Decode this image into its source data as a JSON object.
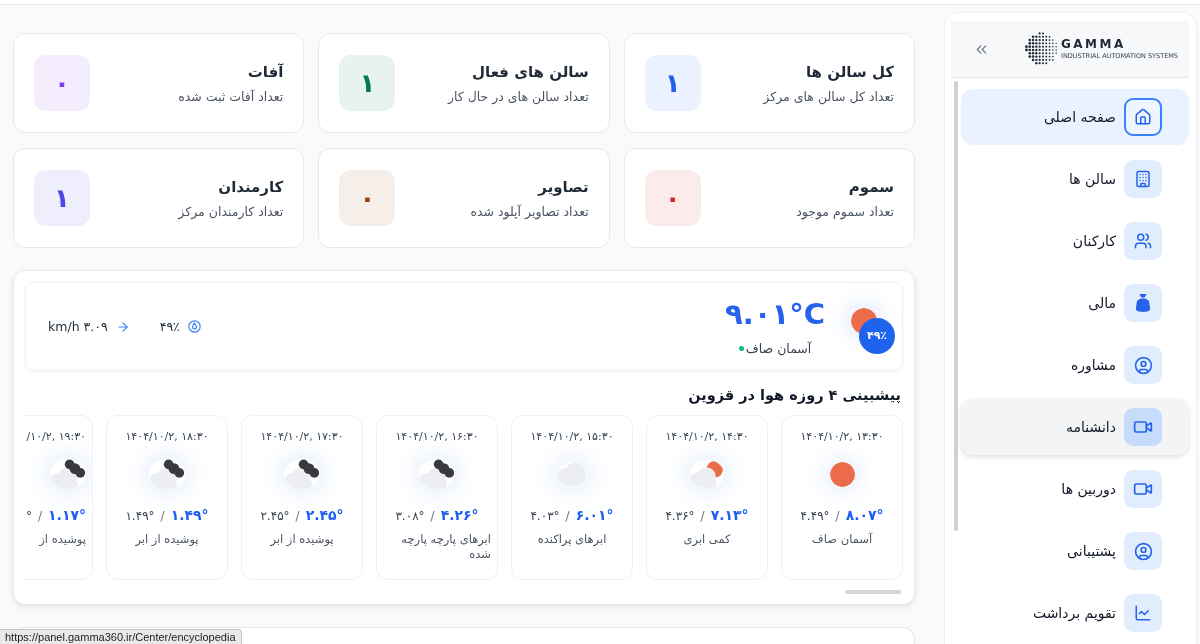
{
  "sidebar": {
    "logo": {
      "name": "GAMMA",
      "tagline": "INDUSTRIAL AUTOMATION SYSTEMS"
    },
    "items": [
      {
        "label": "صفحه اصلی",
        "selected": true,
        "hovered": false
      },
      {
        "label": "سالن ها",
        "selected": false,
        "hovered": false
      },
      {
        "label": "کارکنان",
        "selected": false,
        "hovered": false
      },
      {
        "label": "مالی",
        "selected": false,
        "hovered": false
      },
      {
        "label": "مشاوره",
        "selected": false,
        "hovered": false
      },
      {
        "label": "دانشنامه",
        "selected": false,
        "hovered": true
      },
      {
        "label": "دوربین ها",
        "selected": false,
        "hovered": false
      },
      {
        "label": "پشتیبانی",
        "selected": false,
        "hovered": false
      },
      {
        "label": "تقویم برداشت",
        "selected": false,
        "hovered": false
      }
    ]
  },
  "stats": [
    {
      "title": "کل سالن ها",
      "subtitle": "تعداد کل سالن های مرکز",
      "value": "۱",
      "color": "#1d5ff0"
    },
    {
      "title": "سالن های فعال",
      "subtitle": "تعداد سالن های در حال کار",
      "value": "۱",
      "color": "#047857"
    },
    {
      "title": "آفات",
      "subtitle": "تعداد آفات ثبت شده",
      "value": "۰",
      "color": "#7c3aed"
    },
    {
      "title": "سموم",
      "subtitle": "تعداد سموم موجود",
      "value": "۰",
      "color": "#dc2626"
    },
    {
      "title": "تصاویر",
      "subtitle": "تعداد تصاویر آپلود شده",
      "value": "۰",
      "color": "#92400e"
    },
    {
      "title": "کارمندان",
      "subtitle": "تعداد کارمندان مرکز",
      "value": "۱",
      "color": "#4f46e5"
    }
  ],
  "weather": {
    "current": {
      "kind": "clear",
      "badge": "۴۹٪",
      "temperature": "۹.۰۱°C",
      "condition": "آسمان صاف",
      "humidity": "۴۹٪",
      "wind": "۳.۰۹ km/h"
    },
    "forecast_title": "پیشبینی ۴ روزه هوا در قزوین",
    "forecast": [
      {
        "time": "۱۴۰۴/۱۰/۲, ۱۳:۳۰",
        "kind": "clear",
        "max": "۸.۰۷°",
        "separator": "/",
        "min": "۴.۴۹°",
        "description": "آسمان صاف"
      },
      {
        "time": "۱۴۰۴/۱۰/۲, ۱۴:۳۰",
        "kind": "few-clouds",
        "max": "۷.۱۳°",
        "separator": "/",
        "min": "۴.۳۶°",
        "description": "کمی ابری"
      },
      {
        "time": "۱۴۰۴/۱۰/۲, ۱۵:۳۰",
        "kind": "scattered",
        "max": "۶.۰۱°",
        "separator": "/",
        "min": "۴.۰۳°",
        "description": "ابرهای پراکنده"
      },
      {
        "time": "۱۴۰۴/۱۰/۲, ۱۶:۳۰",
        "kind": "broken",
        "max": "۴.۲۶°",
        "separator": "/",
        "min": "۳.۰۸°",
        "description": "ابرهای پارچه پارچه شده"
      },
      {
        "time": "۱۴۰۴/۱۰/۲, ۱۷:۳۰",
        "kind": "overcast",
        "max": "۲.۴۵°",
        "separator": "/",
        "min": "۲.۴۵°",
        "description": "پوشیده از ابر"
      },
      {
        "time": "۱۴۰۴/۱۰/۲, ۱۸:۳۰",
        "kind": "overcast",
        "max": "۱.۴۹°",
        "separator": "/",
        "min": "۱.۴۹°",
        "description": "پوشیده از ابر"
      },
      {
        "time": "/۱۰/۲, ۱۹:۳۰",
        "kind": "overcast",
        "max": "۱.۱۷°",
        "separator": "/",
        "min": "°",
        "description": "پوشیده از"
      }
    ]
  },
  "status_url": "https://panel.gamma360.ir/Center/encyclopedia"
}
